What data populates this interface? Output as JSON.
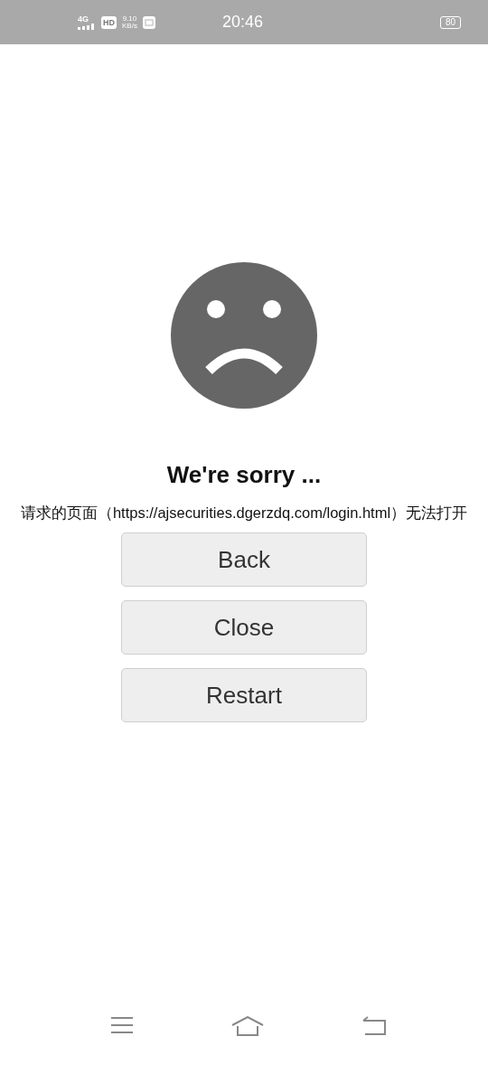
{
  "status_bar": {
    "network": "4G",
    "hd": "HD",
    "speed": "9.10",
    "speed_unit": "KB/s",
    "time": "20:46",
    "battery": "80"
  },
  "title": "We're sorry ...",
  "message": "请求的页面（https://ajsecurities.dgerzdq.com/login.html）无法打开",
  "buttons": [
    "Back",
    "Close",
    "Restart"
  ]
}
